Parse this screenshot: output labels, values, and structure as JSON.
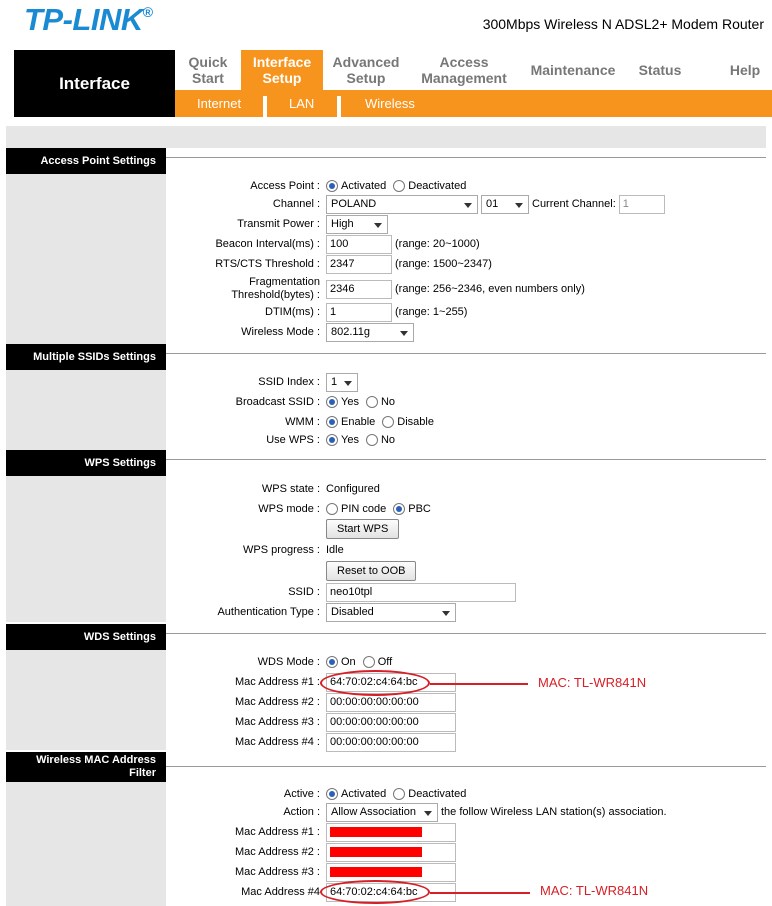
{
  "brand": {
    "logo": "TP-LINK",
    "product": "300Mbps Wireless N ADSL2+ Modem Router"
  },
  "nav": {
    "section": "Interface",
    "tabs": [
      "Quick\nStart",
      "Interface\nSetup",
      "Advanced\nSetup",
      "Access\nManagement",
      "Maintenance",
      "Status",
      "Help"
    ],
    "subtabs": [
      "Internet",
      "LAN",
      "Wireless"
    ]
  },
  "ap": {
    "title": "Access Point Settings",
    "access_point_label": "Access Point :",
    "activated": "Activated",
    "deactivated": "Deactivated",
    "channel_label": "Channel :",
    "country": "POLAND",
    "channel": "01",
    "current_channel_label": "Current Channel:",
    "current_channel": "1",
    "transmit_power_label": "Transmit Power :",
    "transmit_power": "High",
    "beacon_label": "Beacon Interval(ms) :",
    "beacon": "100",
    "beacon_range": "(range: 20~1000)",
    "rts_label": "RTS/CTS Threshold :",
    "rts": "2347",
    "rts_range": "(range: 1500~2347)",
    "frag_label1": "Fragmentation",
    "frag_label2": "Threshold(bytes)",
    "frag": "2346",
    "frag_range": "(range: 256~2346, even numbers only)",
    "dtim_label": "DTIM(ms) :",
    "dtim": "1",
    "dtim_range": "(range: 1~255)",
    "mode_label": "Wireless Mode :",
    "mode": "802.11g"
  },
  "ssid": {
    "title": "Multiple SSIDs Settings",
    "index_label": "SSID Index :",
    "index": "1",
    "broadcast_label": "Broadcast SSID :",
    "yes": "Yes",
    "no": "No",
    "wmm_label": "WMM :",
    "enable": "Enable",
    "disable": "Disable",
    "wps_label": "Use WPS :"
  },
  "wps": {
    "title": "WPS Settings",
    "state_label": "WPS state :",
    "state": "Configured",
    "mode_label": "WPS mode :",
    "pin": "PIN code",
    "pbc": "PBC",
    "start": "Start WPS",
    "progress_label": "WPS progress :",
    "progress": "Idle",
    "reset": "Reset to OOB",
    "ssid_label": "SSID :",
    "ssid": "neo10tpl",
    "auth_label": "Authentication Type :",
    "auth": "Disabled"
  },
  "wds": {
    "title": "WDS Settings",
    "mode_label": "WDS Mode :",
    "on": "On",
    "off": "Off",
    "mac1_label": "Mac Address #1 :",
    "mac1": "64:70:02:c4:64:bc",
    "mac2_label": "Mac Address #2 :",
    "mac2": "00:00:00:00:00:00",
    "mac3_label": "Mac Address #3 :",
    "mac3": "00:00:00:00:00:00",
    "mac4_label": "Mac Address #4 :",
    "mac4": "00:00:00:00:00:00",
    "annotation": "MAC: TL-WR841N"
  },
  "filter": {
    "title1": "Wireless MAC Address",
    "title2": "Filter",
    "active_label": "Active :",
    "activated": "Activated",
    "deactivated": "Deactivated",
    "action_label": "Action :",
    "action": "Allow Association",
    "action_suffix": "the follow Wireless LAN station(s) association.",
    "mac1_label": "Mac Address #1 :",
    "mac2_label": "Mac Address #2 :",
    "mac3_label": "Mac Address #3 :",
    "mac4_label": "Mac Address #4",
    "mac4": "64:70:02:c4:64:bc",
    "annotation": "MAC: TL-WR841N"
  },
  "colors": {
    "brand_blue": "#1a8bd2",
    "nav_orange": "#f7941d",
    "annotation_red": "#d61f26"
  }
}
